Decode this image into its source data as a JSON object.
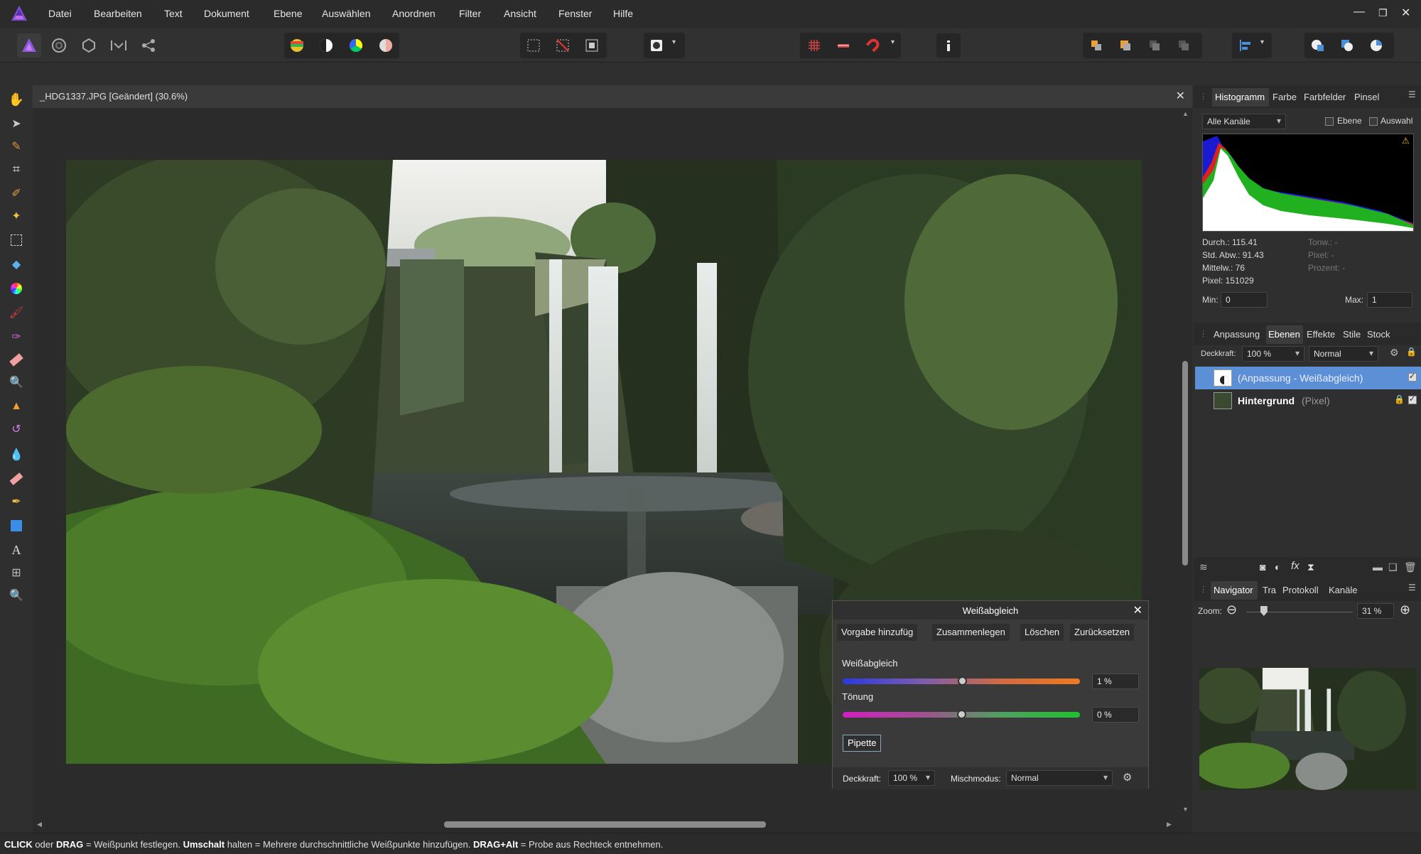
{
  "menu": {
    "items": [
      "Datei",
      "Bearbeiten",
      "Text",
      "Dokument",
      "Ebene",
      "Auswählen",
      "Anordnen",
      "Filter",
      "Ansicht",
      "Fenster",
      "Hilfe"
    ]
  },
  "document": {
    "title": "_HDG1337.JPG [Geändert] (30.6%)"
  },
  "histogram_panel": {
    "tabs": [
      "Histogramm",
      "Farbe",
      "Farbfelder",
      "Pinsel"
    ],
    "channel": "Alle Kanäle",
    "opt_layer": "Ebene",
    "opt_selection": "Auswahl",
    "stats": {
      "mean": "Durch.: 115.41",
      "std": "Std. Abw.: 91.43",
      "median": "Mittelw.: 76",
      "pixels": "Pixel: 151029",
      "tone": "Tonw.: -",
      "pixel_r": "Pixel: -",
      "percent": "Prozent: -"
    },
    "min_label": "Min:",
    "min_value": "0",
    "max_label": "Max:",
    "max_value": "1"
  },
  "layers_panel": {
    "tabs": [
      "Anpassung",
      "Ebenen",
      "Effekte",
      "Stile",
      "Stock"
    ],
    "opacity_label": "Deckkraft:",
    "opacity_value": "100 %",
    "blend_mode": "Normal",
    "layers": [
      {
        "name": "(Anpassung - Weißabgleich)",
        "type": ""
      },
      {
        "name": "Hintergrund",
        "type": "(Pixel)"
      }
    ]
  },
  "navigator_panel": {
    "tabs": [
      "Navigator",
      "Tra",
      "Protokoll",
      "Kanäle"
    ],
    "zoom_label": "Zoom:",
    "zoom_value": "31 %",
    "zoom_fraction": 0.31
  },
  "wb_dialog": {
    "title": "Weißabgleich",
    "buttons": [
      "Vorgabe hinzufüg",
      "Zusammenlegen",
      "Löschen",
      "Zurücksetzen"
    ],
    "wb_label": "Weißabgleich",
    "wb_value": "1 %",
    "wb_fraction": 0.505,
    "tint_label": "Tönung",
    "tint_value": "0 %",
    "tint_fraction": 0.5,
    "pipette": "Pipette",
    "opacity_label": "Deckkraft:",
    "opacity_value": "100 %",
    "blend_label": "Mischmodus:",
    "blend_value": "Normal"
  },
  "status": {
    "b1": "CLICK",
    "t1": " oder ",
    "b2": "DRAG",
    "t2": " = Weißpunkt festlegen. ",
    "b3": "Umschalt",
    "t3": " halten = Mehrere durchschnittliche Weißpunkte hinzufügen. ",
    "b4": "DRAG+Alt",
    "t4": " = Probe aus Rechteck entnehmen."
  },
  "colors": {
    "accent": "#4a90d9",
    "selected_layer": "#5b8fd6"
  }
}
